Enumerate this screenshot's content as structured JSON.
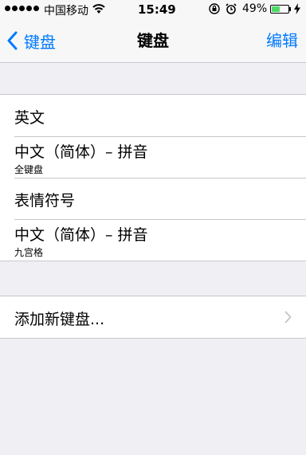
{
  "status_bar": {
    "carrier": "中国移动",
    "time": "15:49",
    "battery_percent": "49%",
    "battery_level": 0.49,
    "signal_dots": 5
  },
  "nav": {
    "back_label": "键盘",
    "title": "键盘",
    "edit_label": "编辑"
  },
  "keyboards": [
    {
      "label": "英文",
      "sub": ""
    },
    {
      "label": "中文（简体）– 拼音",
      "sub": "全键盘"
    },
    {
      "label": "表情符号",
      "sub": ""
    },
    {
      "label": "中文（简体）– 拼音",
      "sub": "九宫格"
    }
  ],
  "add_keyboard": {
    "label": "添加新键盘..."
  },
  "colors": {
    "accent": "#007aff",
    "background": "#efeff4",
    "battery": "#4cd964"
  }
}
